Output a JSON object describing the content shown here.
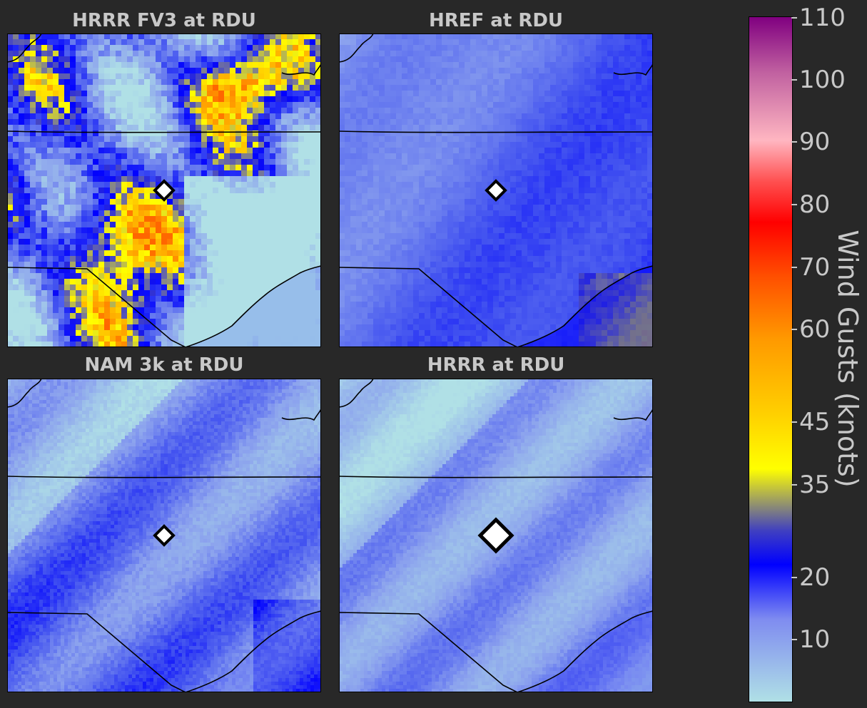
{
  "panels": [
    {
      "title": "HRRR FV3 at RDU",
      "pattern": "storm",
      "marker": "small"
    },
    {
      "title": "HREF at RDU",
      "pattern": "smooth",
      "marker": "small"
    },
    {
      "title": "NAM 3k at RDU",
      "pattern": "streaky",
      "marker": "small"
    },
    {
      "title": "HRRR at RDU",
      "pattern": "light",
      "marker": "large"
    }
  ],
  "colorbar": {
    "label": "Wind Gusts (knots)",
    "ticks": [
      "10",
      "20",
      "35",
      "45",
      "60",
      "70",
      "80",
      "90",
      "100",
      "110"
    ],
    "colors": {
      "light_blue": "#b0e0e6",
      "blue": "#0000ff",
      "gray": "#808080",
      "yellow": "#ffff00",
      "orange": "#ff9900",
      "red": "#ff0000",
      "pink": "#ffb6c1",
      "purple": "#800080"
    }
  }
}
